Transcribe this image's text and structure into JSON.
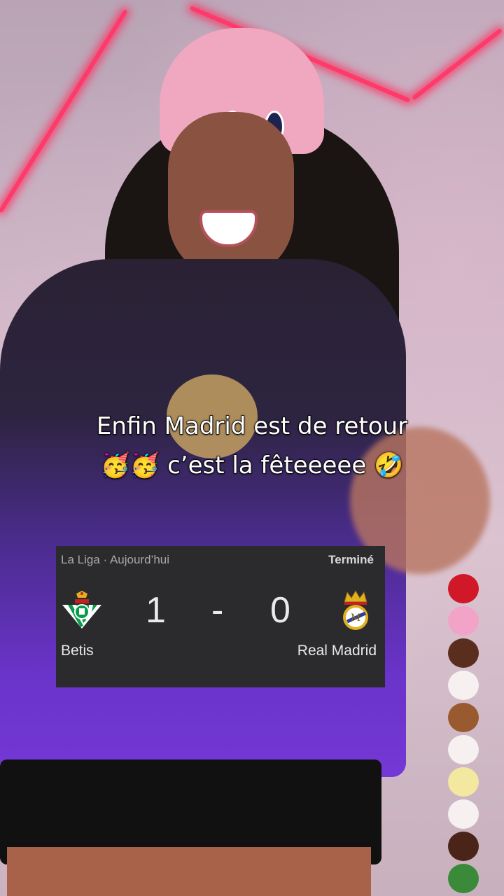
{
  "caption": {
    "line1": "Enfin Madrid est de retour",
    "line2": "🥳🥳 c’est la fêteeeee 🤣"
  },
  "match": {
    "league_date": "La Liga · Aujourd’hui",
    "status": "Terminé",
    "home_team": "Betis",
    "away_team": "Real Madrid",
    "home_score": "1",
    "separator": "-",
    "away_score": "0",
    "home_crest_icon": "real-betis-crest-icon",
    "away_crest_icon": "real-madrid-crest-icon"
  },
  "colors": {
    "card_bg": "#2b2b2d",
    "led": "#ff3a6a",
    "betis_green": "#0a9b4a",
    "madrid_gold": "#e0b020"
  }
}
